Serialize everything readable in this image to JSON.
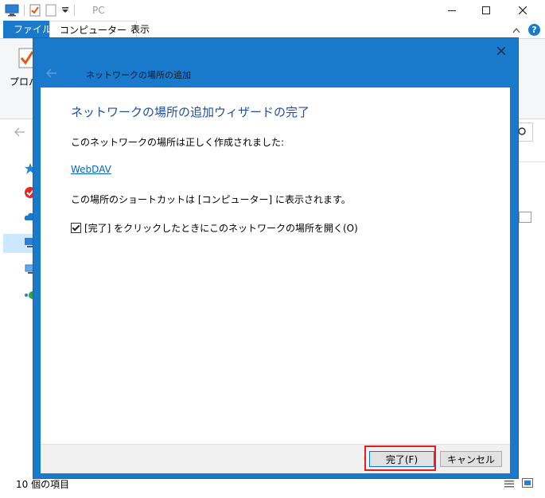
{
  "window": {
    "title": "PC"
  },
  "ribbon": {
    "tabs": [
      {
        "label": "ファイル"
      },
      {
        "label": "コンピューター"
      },
      {
        "label": "表示"
      }
    ],
    "properties_label": "プロパ",
    "help_label": "?"
  },
  "status_bar": {
    "item_count": "10 個の項目"
  },
  "dialog": {
    "title": "ネットワークの場所の追加",
    "heading": "ネットワークの場所の追加ウィザードの完了",
    "created_text": "このネットワークの場所は正しく作成されました:",
    "location_name": "WebDAV",
    "shortcut_text": "この場所のショートカットは [コンピューター] に表示されます。",
    "open_checkbox_label": "[完了] をクリックしたときにこのネットワークの場所を開く(O)",
    "open_checkbox_checked": true,
    "finish_button": "完了(F)",
    "cancel_button": "キャンセル"
  },
  "colors": {
    "accent": "#1979ca",
    "heading": "#1f4e9a",
    "highlight": "#e02020"
  }
}
